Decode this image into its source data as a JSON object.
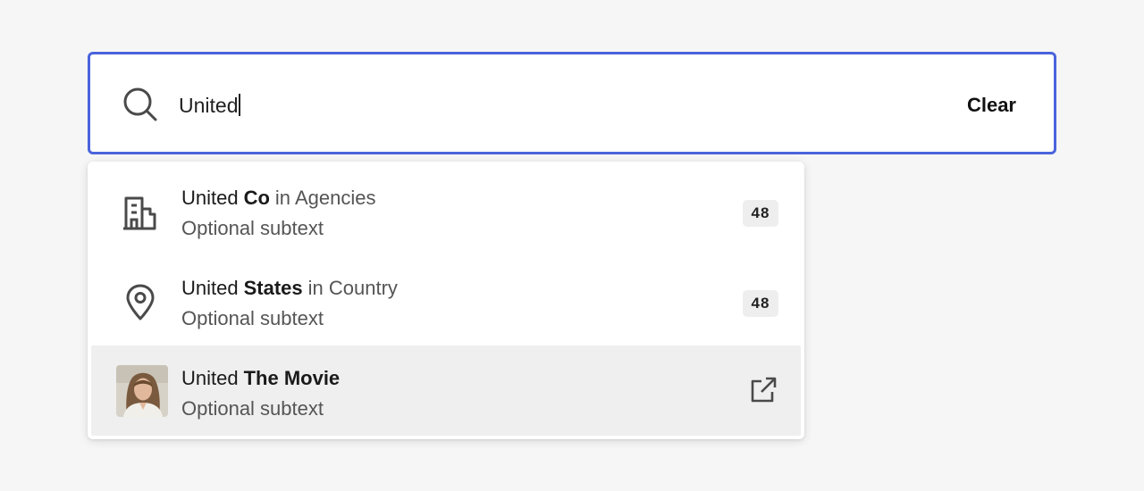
{
  "search": {
    "value": "United",
    "clear_label": "Clear"
  },
  "results": [
    {
      "icon": "building-icon",
      "match": "United",
      "rest": "Co",
      "category": "in Agencies",
      "subtext": "Optional subtext",
      "count": "48"
    },
    {
      "icon": "map-pin-icon",
      "match": "United",
      "rest": "States",
      "category": "in Country",
      "subtext": "Optional subtext",
      "count": "48"
    },
    {
      "icon": "avatar",
      "match": "United",
      "rest": "The Movie",
      "category": "",
      "subtext": "Optional subtext",
      "action_icon": "external-link-icon",
      "highlighted": true
    }
  ],
  "colors": {
    "accent": "#4a64dc",
    "highlight": "#efefef",
    "badge_bg": "#eeeeee"
  }
}
